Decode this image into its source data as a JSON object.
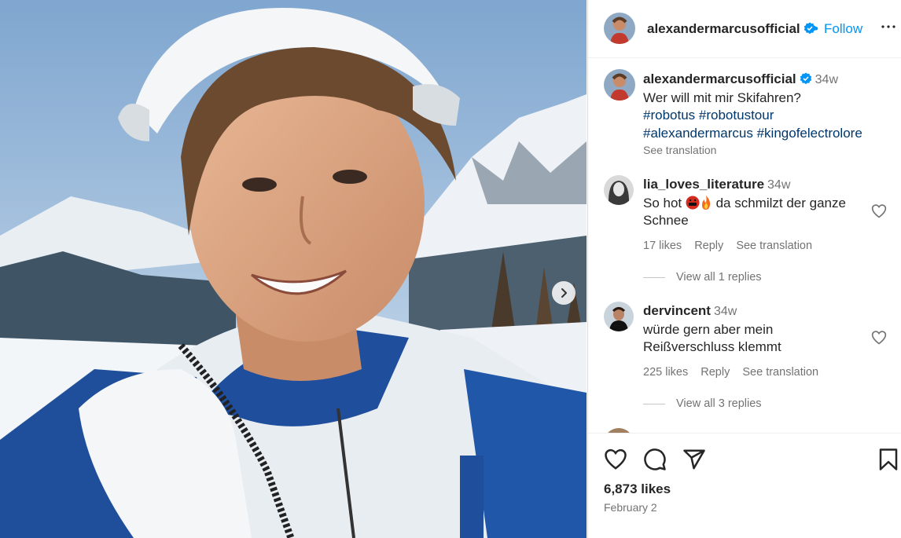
{
  "post": {
    "username": "alexandermarcusofficial",
    "follow_label": "Follow",
    "dot": "•",
    "likes": "6,873 likes",
    "date": "February 2"
  },
  "caption": {
    "username": "alexandermarcusofficial",
    "time": "34w",
    "text": "Wer will mit mir Skifahren?",
    "hashtags": [
      "#robotus",
      "#robotustour",
      "#alexandermarcus",
      "#kingofelectrolore"
    ],
    "see_translation": "See translation"
  },
  "comments": [
    {
      "username": "lia_loves_literature",
      "time": "34w",
      "text_before": "So hot ",
      "emojis": [
        "face-with-symbols-emoji",
        "fire-emoji"
      ],
      "text_after": " da schmilzt der ganze Schnee",
      "likes": "17 likes",
      "reply": "Reply",
      "see_translation": "See translation",
      "view_replies": "View all 1 replies"
    },
    {
      "username": "dervincent",
      "time": "34w",
      "text": "würde gern aber mein Reißverschluss klemmt",
      "likes": "225 likes",
      "reply": "Reply",
      "see_translation": "See translation",
      "view_replies": "View all 3 replies"
    }
  ],
  "icons": [
    "verified-icon",
    "more-icon",
    "heart-icon",
    "comment-icon",
    "share-icon",
    "bookmark-icon",
    "chevron-right-icon"
  ],
  "colors": {
    "link": "#0095f6",
    "hashtag": "#00376b",
    "muted": "#737373",
    "verified": "#0095f6"
  }
}
